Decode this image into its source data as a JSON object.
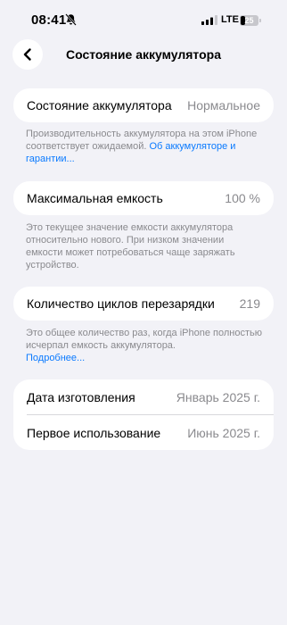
{
  "status_bar": {
    "time": "08:41",
    "network": "LTE",
    "battery_level": "25"
  },
  "nav": {
    "title": "Состояние аккумулятора"
  },
  "battery_health": {
    "label": "Состояние аккумулятора",
    "value": "Нормальное",
    "footnote": "Производительность аккумулятора на этом iPhone соответствует ожидаемой. ",
    "footnote_link": "Об аккумуляторе и гарантии..."
  },
  "max_capacity": {
    "label": "Максимальная емкость",
    "value": "100 %",
    "footnote": "Это текущее значение емкости аккумулятора относительно нового. При низком значении емкости может потребоваться чаще заряжать устройство."
  },
  "cycle_count": {
    "label": "Количество циклов перезарядки",
    "value": "219",
    "footnote": "Это общее количество раз, когда iPhone полностью исчерпал емкость аккумулятора.",
    "footnote_link": "Подробнее..."
  },
  "dates": {
    "manufacture_label": "Дата изготовления",
    "manufacture_value": "Январь 2025 г.",
    "first_use_label": "Первое использование",
    "first_use_value": "Июнь 2025 г."
  }
}
